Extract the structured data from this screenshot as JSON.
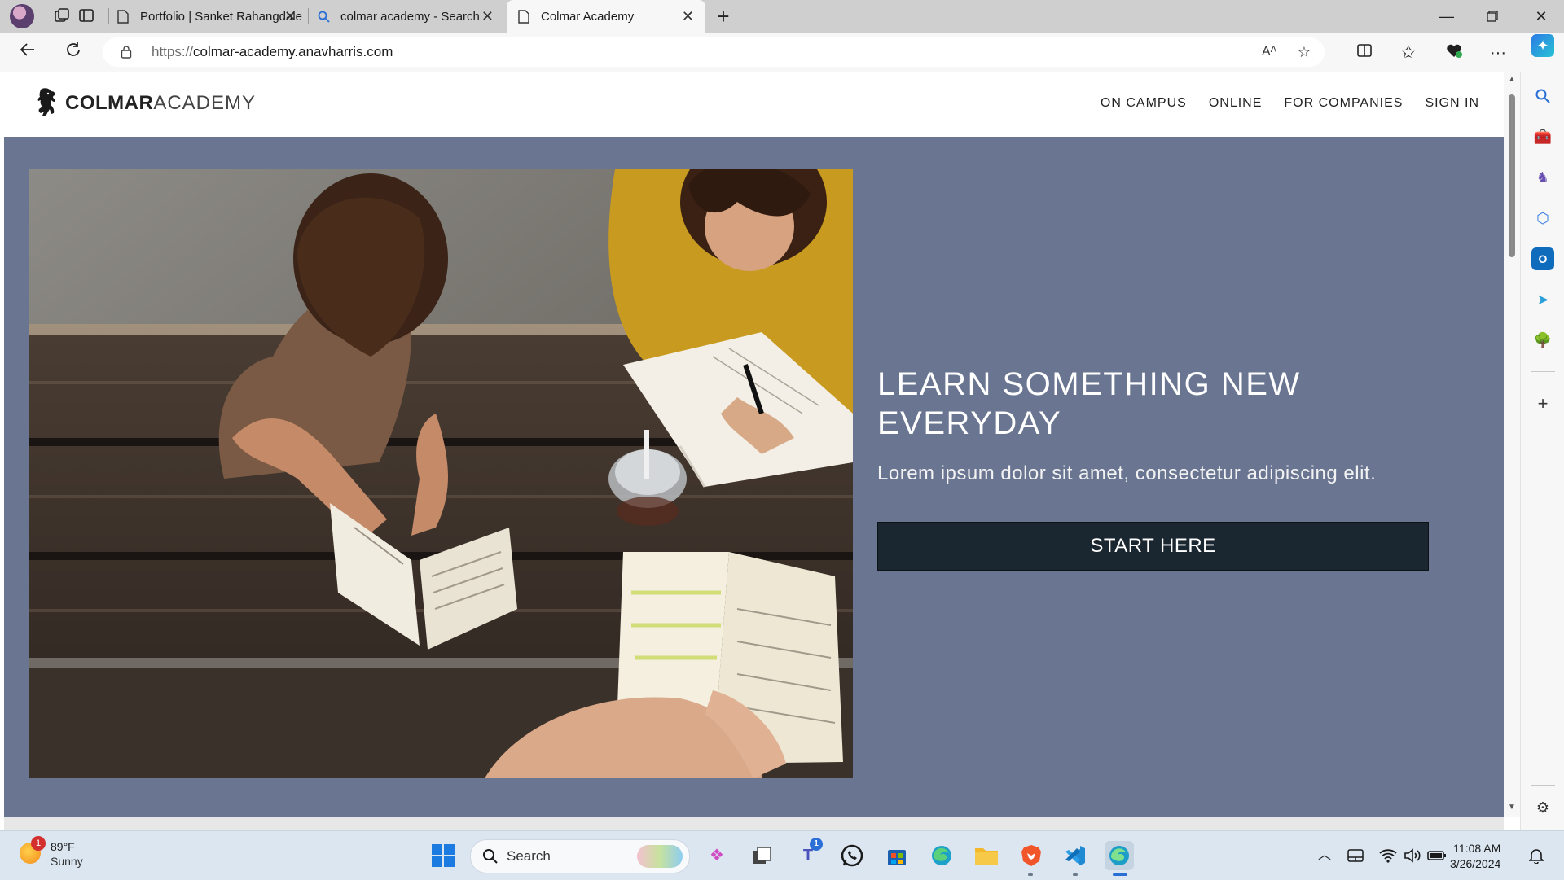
{
  "browser": {
    "tabs": [
      {
        "title": "Portfolio | Sanket Rahangdale",
        "active": false
      },
      {
        "title": "colmar academy - Search",
        "active": false
      },
      {
        "title": "Colmar Academy",
        "active": true
      }
    ],
    "new_tab_symbol": "+",
    "url_protocol": "https://",
    "url_host": "colmar-academy.anavharris.com",
    "read_aloud_label": "Aᴬ"
  },
  "site": {
    "brand_bold": "COLMAR",
    "brand_light": "ACADEMY",
    "nav": [
      "ON CAMPUS",
      "ONLINE",
      "FOR COMPANIES",
      "SIGN IN"
    ],
    "hero_title": "LEARN SOMETHING NEW EVERYDAY",
    "hero_subtitle": "Lorem ipsum dolor sit amet, consectetur adipiscing elit.",
    "cta_label": "START HERE",
    "hero_bg_color": "#6a7591",
    "cta_color": "#1b2730"
  },
  "taskbar": {
    "weather_temp": "89°F",
    "weather_condition": "Sunny",
    "weather_badge": "1",
    "search_label": "Search",
    "teams_badge": "1",
    "time": "11:08 AM",
    "date": "3/26/2024"
  }
}
